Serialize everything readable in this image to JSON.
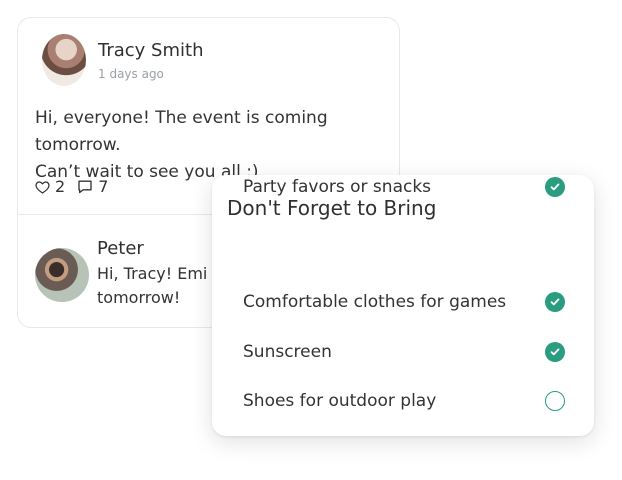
{
  "post": {
    "author": "Tracy Smith",
    "timestamp": "1 days ago",
    "text_line_1": "Hi, everyone! The event is coming tomorrow.",
    "text_line_2": "Can’t wait to see you all :)",
    "likes": "2",
    "comments": "7"
  },
  "reply": {
    "name": "Peter",
    "text_line_1": "Hi, Tracy! Emi lo",
    "text_line_2": "tomorrow!"
  },
  "checklist": {
    "title": "Don't Forget to Bring",
    "items": [
      {
        "label": "Comfortable clothes for games",
        "checked": true
      },
      {
        "label": "Sunscreen",
        "checked": true
      },
      {
        "label": "Shoes for outdoor play",
        "checked": false
      },
      {
        "label": "Party favors or snacks",
        "checked": true
      }
    ]
  },
  "colors": {
    "accent": "#2a9c80",
    "text": "#303030",
    "muted": "#9aa0a6",
    "border": "#e6e8ea"
  },
  "icons": {
    "like": "heart-outline-icon",
    "comment": "comment-outline-icon",
    "check": "check-icon"
  }
}
